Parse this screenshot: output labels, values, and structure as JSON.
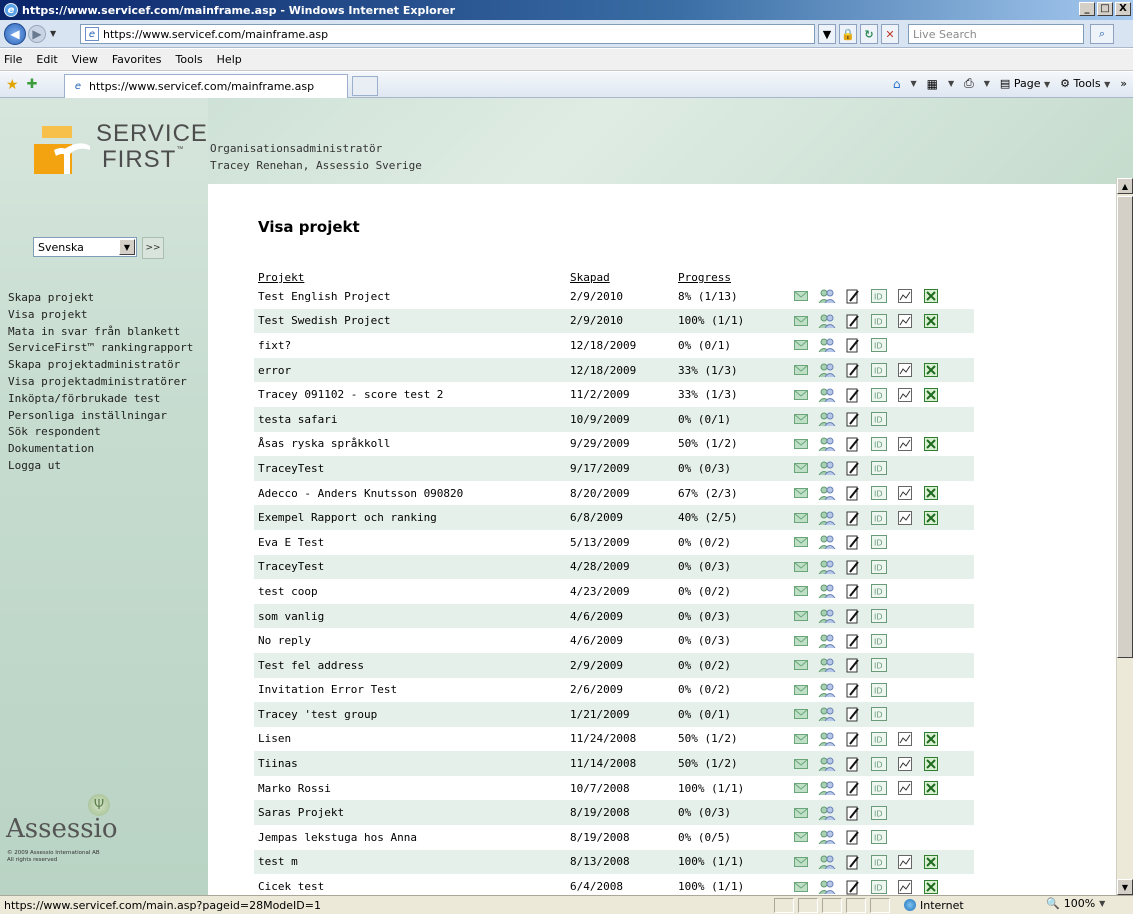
{
  "window": {
    "title": "https://www.servicef.com/mainframe.asp - Windows Internet Explorer",
    "controls": [
      "_",
      "□",
      "X"
    ]
  },
  "address": {
    "url": "https://www.servicef.com/mainframe.asp",
    "search_placeholder": "Live Search"
  },
  "menubar": [
    "File",
    "Edit",
    "View",
    "Favorites",
    "Tools",
    "Help"
  ],
  "tab": {
    "label": "https://www.servicef.com/mainframe.asp"
  },
  "commandbar": {
    "page": "Page",
    "tools": "Tools"
  },
  "header": {
    "logo_line1": "SERVICE",
    "logo_line2": "FIRST",
    "logo_tm": "™",
    "role": "Organisationsadministratör",
    "user": "Tracey Renehan, Assessio Sverige"
  },
  "sidebar": {
    "language": "Svenska",
    "go_label": ">>",
    "items": [
      "Skapa projekt",
      "Visa projekt",
      "Mata in svar från blankett",
      "ServiceFirst™ rankingrapport",
      "Skapa projektadministratör",
      "Visa projektadministratörer",
      "Inköpta/förbrukade test",
      "Personliga inställningar",
      "Sök respondent",
      "Dokumentation",
      "Logga ut"
    ],
    "brand": "Assessio",
    "copyright1": "© 2009 Assessio International AB",
    "copyright2": "All rights reserved"
  },
  "main": {
    "title": "Visa projekt",
    "columns": {
      "project": "Projekt",
      "created": "Skapad",
      "progress": "Progress"
    },
    "icon_names": [
      "mail-icon",
      "users-icon",
      "edit-icon",
      "id-icon",
      "chart-icon",
      "excel-icon"
    ],
    "rows": [
      {
        "name": "Test English Project",
        "date": "2/9/2010",
        "progress": "8% (1/13)",
        "chart": true,
        "excel": true
      },
      {
        "name": "Test Swedish Project",
        "date": "2/9/2010",
        "progress": "100% (1/1)",
        "chart": true,
        "excel": true
      },
      {
        "name": "fixt?",
        "date": "12/18/2009",
        "progress": "0% (0/1)",
        "chart": false,
        "excel": false
      },
      {
        "name": "error",
        "date": "12/18/2009",
        "progress": "33% (1/3)",
        "chart": true,
        "excel": true
      },
      {
        "name": "Tracey 091102 - score test 2",
        "date": "11/2/2009",
        "progress": "33% (1/3)",
        "chart": true,
        "excel": true
      },
      {
        "name": "testa safari",
        "date": "10/9/2009",
        "progress": "0% (0/1)",
        "chart": false,
        "excel": false
      },
      {
        "name": "Åsas ryska språkkoll",
        "date": "9/29/2009",
        "progress": "50% (1/2)",
        "chart": true,
        "excel": true
      },
      {
        "name": "TraceyTest",
        "date": "9/17/2009",
        "progress": "0% (0/3)",
        "chart": false,
        "excel": false
      },
      {
        "name": "Adecco - Anders Knutsson 090820",
        "date": "8/20/2009",
        "progress": "67% (2/3)",
        "chart": true,
        "excel": true
      },
      {
        "name": "Exempel Rapport och ranking",
        "date": "6/8/2009",
        "progress": "40% (2/5)",
        "chart": true,
        "excel": true
      },
      {
        "name": "Eva E Test",
        "date": "5/13/2009",
        "progress": "0% (0/2)",
        "chart": false,
        "excel": false
      },
      {
        "name": "TraceyTest",
        "date": "4/28/2009",
        "progress": "0% (0/3)",
        "chart": false,
        "excel": false
      },
      {
        "name": "test coop",
        "date": "4/23/2009",
        "progress": "0% (0/2)",
        "chart": false,
        "excel": false
      },
      {
        "name": "som vanlig",
        "date": "4/6/2009",
        "progress": "0% (0/3)",
        "chart": false,
        "excel": false
      },
      {
        "name": "No reply",
        "date": "4/6/2009",
        "progress": "0% (0/3)",
        "chart": false,
        "excel": false
      },
      {
        "name": "Test fel address",
        "date": "2/9/2009",
        "progress": "0% (0/2)",
        "chart": false,
        "excel": false
      },
      {
        "name": "Invitation Error Test",
        "date": "2/6/2009",
        "progress": "0% (0/2)",
        "chart": false,
        "excel": false
      },
      {
        "name": "Tracey 'test group",
        "date": "1/21/2009",
        "progress": "0% (0/1)",
        "chart": false,
        "excel": false
      },
      {
        "name": "Lisen",
        "date": "11/24/2008",
        "progress": "50% (1/2)",
        "chart": true,
        "excel": true
      },
      {
        "name": "Tiinas",
        "date": "11/14/2008",
        "progress": "50% (1/2)",
        "chart": true,
        "excel": true
      },
      {
        "name": "Marko Rossi",
        "date": "10/7/2008",
        "progress": "100% (1/1)",
        "chart": true,
        "excel": true
      },
      {
        "name": "Saras Projekt",
        "date": "8/19/2008",
        "progress": "0% (0/3)",
        "chart": false,
        "excel": false
      },
      {
        "name": "Jempas lekstuga hos Anna",
        "date": "8/19/2008",
        "progress": "0% (0/5)",
        "chart": false,
        "excel": false
      },
      {
        "name": "test m",
        "date": "8/13/2008",
        "progress": "100% (1/1)",
        "chart": true,
        "excel": true
      },
      {
        "name": "Cicek test",
        "date": "6/4/2008",
        "progress": "100% (1/1)",
        "chart": true,
        "excel": true
      }
    ]
  },
  "status": {
    "url": "https://www.servicef.com/main.asp?pageid=28ModeID=1",
    "zone": "Internet",
    "zoom": "100%"
  },
  "colors": {
    "sidebar_green": "#c6dccf",
    "row_alt": "#e6f0ea",
    "titlebar": "#0a246a"
  }
}
